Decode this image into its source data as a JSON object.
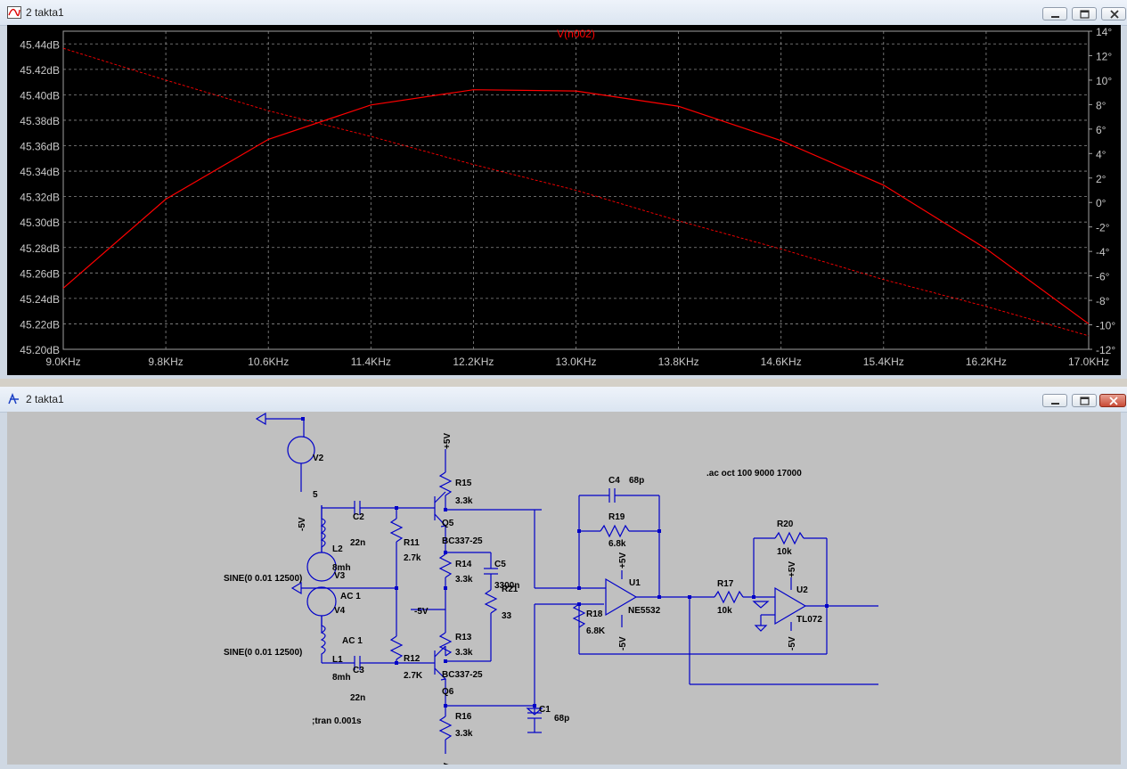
{
  "plot_window": {
    "title": "2 takta1",
    "trace_label": "V(n002)"
  },
  "schematic_window": {
    "title": "2 takta1"
  },
  "chart_data": {
    "type": "line",
    "title": "V(n002)",
    "xlabel": "",
    "ylabel": "",
    "x_ticks": [
      "9.0KHz",
      "9.8KHz",
      "10.6KHz",
      "11.4KHz",
      "12.2KHz",
      "13.0KHz",
      "13.8KHz",
      "14.6KHz",
      "15.4KHz",
      "16.2KHz",
      "17.0KHz"
    ],
    "y_left_ticks": [
      "45.44dB",
      "45.42dB",
      "45.40dB",
      "45.38dB",
      "45.36dB",
      "45.34dB",
      "45.32dB",
      "45.30dB",
      "45.28dB",
      "45.26dB",
      "45.24dB",
      "45.22dB",
      "45.20dB"
    ],
    "y_right_ticks": [
      "14°",
      "12°",
      "10°",
      "8°",
      "6°",
      "4°",
      "2°",
      "0°",
      "-2°",
      "-4°",
      "-6°",
      "-8°",
      "-10°",
      "-12°"
    ],
    "xlim": [
      9.0,
      17.0
    ],
    "ylim_left": [
      45.2,
      45.45
    ],
    "ylim_right": [
      -12,
      14
    ],
    "grid": true,
    "color": "#ff0000",
    "series": [
      {
        "style": "solid",
        "axis": "left",
        "x": [
          9.0,
          9.8,
          10.6,
          11.4,
          12.2,
          13.0,
          13.8,
          14.6,
          15.4,
          16.2,
          17.0
        ],
        "y": [
          45.248,
          45.318,
          45.365,
          45.392,
          45.404,
          45.403,
          45.391,
          45.364,
          45.329,
          45.279,
          45.22
        ]
      },
      {
        "style": "dashed",
        "axis": "right",
        "x": [
          9.0,
          9.8,
          10.6,
          11.4,
          12.2,
          13.0,
          13.8,
          14.6,
          15.4,
          16.2,
          17.0
        ],
        "y": [
          12.6,
          10.0,
          7.5,
          5.4,
          3.1,
          1.0,
          -1.5,
          -3.8,
          -6.3,
          -8.5,
          -10.9
        ]
      }
    ]
  },
  "schematic": {
    "directive_ac": ".ac oct 100 9000 17000",
    "directive_tran": ";tran 0.001s",
    "v2_name": "V2",
    "v2_value": "5",
    "v3_name": "V3",
    "v3_value": "AC 1",
    "v3_func": "SINE(0 0.01 12500)",
    "v4_name": "V4",
    "v4_value": "AC 1",
    "v4_func": "SINE(0 0.01 12500)",
    "c2_name": "C2",
    "c2_value": "22n",
    "c3_name": "C3",
    "c3_value": "22n",
    "c4_name": "C4",
    "c4_value": "68p",
    "c5_name": "C5",
    "c5_value": "3300n",
    "c1_name": "C1",
    "c1_value": "68p",
    "l1_name": "L1",
    "l1_value": "8mh",
    "l2_name": "L2",
    "l2_value": "8mh",
    "r11_name": "R11",
    "r11_value": "2.7k",
    "r12_name": "R12",
    "r12_value": "2.7K",
    "r13_name": "R13",
    "r13_value": "3.3k",
    "r14_name": "R14",
    "r14_value": "3.3k",
    "r15_name": "R15",
    "r15_value": "3.3k",
    "r16_name": "R16",
    "r16_value": "3.3k",
    "r17_name": "R17",
    "r17_value": "10k",
    "r18_name": "R18",
    "r18_value": "6.8K",
    "r19_name": "R19",
    "r19_value": "6.8k",
    "r20_name": "R20",
    "r20_value": "10k",
    "r21_name": "R21",
    "r21_value": "33",
    "q5_name": "Q5",
    "q5_model": "BC337-25",
    "q6_name": "Q6",
    "q6_model": "BC337-25",
    "u1_name": "U1",
    "u1_model": "NE5532",
    "u2_name": "U2",
    "u2_model": "TL072",
    "vpos": "+5V",
    "vneg": "-5V",
    "vneg_mid": "-5V"
  }
}
